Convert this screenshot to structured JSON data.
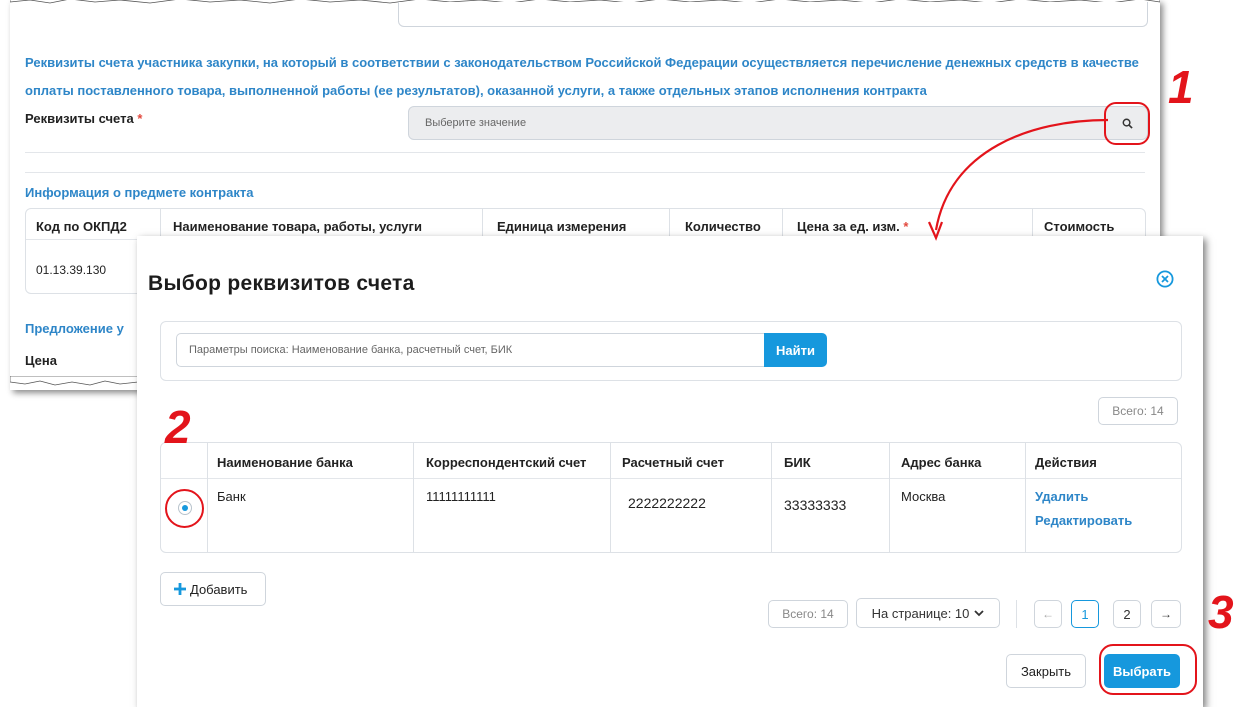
{
  "background_form": {
    "account_section_heading": "Реквизиты счета участника закупки, на который в соответствии с законодательством Российской Федерации осуществляется перечисление денежных средств в качестве оплаты поставленного товара, выполненной работы (ее результатов), оказанной услуги, а также отдельных этапов исполнения контракта",
    "account_label": "Реквизиты счета",
    "required_mark": "*",
    "account_placeholder": "Выберите значение",
    "contract_section_heading": "Информация о предмете контракта",
    "table_headers": [
      "Код по ОКПД2",
      "Наименование товара, работы, услуги",
      "Единица измерения",
      "Количество",
      "Цена за ед. изм.",
      "Стоимость"
    ],
    "row_code": "01.13.39.130",
    "offer_heading_partial": "Предложение у",
    "price_label": "Цена"
  },
  "callouts": {
    "one": "1",
    "two": "2",
    "three": "3"
  },
  "modal": {
    "title": "Выбор реквизитов счета",
    "search_placeholder": "Параметры поиска: Наименование банка, расчетный счет, БИК",
    "find_button": "Найти",
    "total_top": "Всего: 14",
    "columns": [
      "Наименование банка",
      "Корреспондентский счет",
      "Расчетный счет",
      "БИК",
      "Адрес банка",
      "Действия"
    ],
    "row": {
      "bank_name": "Банк",
      "corr_account": "11111111111",
      "account": "2222222222",
      "bik": "33333333",
      "address": "Москва",
      "action_delete": "Удалить",
      "action_edit": "Редактировать"
    },
    "add_button": "Добавить",
    "pagination": {
      "total": "Всего: 14",
      "per_page": "На странице: 10",
      "prev": "←",
      "pages": [
        "1",
        "2"
      ],
      "current_page": "1",
      "next": "→"
    },
    "close_button": "Закрыть",
    "select_button": "Выбрать"
  },
  "colors": {
    "accent": "#1698dd",
    "link": "#2e86c8",
    "callout": "#e3141b",
    "required": "#e2483d"
  },
  "icons": [
    "search-icon",
    "close-circle-icon",
    "plus-icon",
    "chevron-down-icon",
    "arrow-left-icon",
    "arrow-right-icon"
  ]
}
